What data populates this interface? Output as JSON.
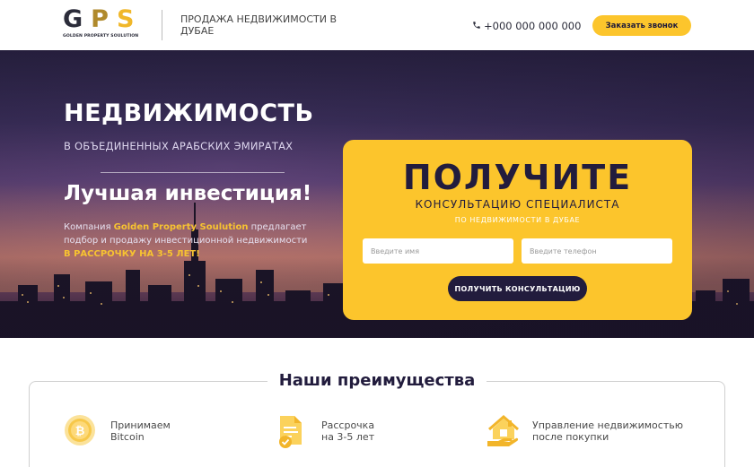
{
  "header": {
    "logo_letters": [
      "G",
      "P",
      "S"
    ],
    "logo_subtitle": "GOLDEN PROPERTY SOULUTION",
    "tagline": "ПРОДАЖА НЕДВИЖИМОСТИ В ДУБАЕ",
    "phone": "+000 000 000 000",
    "callback_button": "Заказать звонок"
  },
  "hero": {
    "title": "НЕДВИЖИМОСТЬ",
    "subtitle": "В ОБЪЕДИНЕННЫХ АРАБСКИХ ЭМИРАТАХ",
    "headline": "Лучшая инвестиция!",
    "desc_prefix": "Компания ",
    "desc_company": "Golden Property Soulution",
    "desc_suffix": " предлагает подбор и продажу инвестиционной недвижимости",
    "installment": "В РАССРОЧКУ НА 3-5 ЛЕТ!"
  },
  "form": {
    "title": "ПОЛУЧИТЕ",
    "subtitle": "КОНСУЛЬТАЦИЮ СПЕЦИАЛИСТА",
    "subtitle2": "ПО НЕДВИЖИМОСТИ В ДУБАЕ",
    "name_placeholder": "Введите имя",
    "phone_placeholder": "Введите телефон",
    "submit_button": "ПОЛУЧИТЬ КОНСУЛЬТАЦИЮ"
  },
  "advantages": {
    "title": "Наши преимущества",
    "items": [
      {
        "icon": "bitcoin-icon",
        "line1": "Принимаем",
        "line2": "Bitcoin"
      },
      {
        "icon": "document-check-icon",
        "line1": "Рассрочка",
        "line2": "на 3-5 лет"
      },
      {
        "icon": "house-hand-icon",
        "line1": "Управление недвижимостью",
        "line2": "после покупки"
      }
    ]
  },
  "colors": {
    "accent": "#fcc52c",
    "dark": "#221c3d",
    "gold_text": "#f7c331"
  }
}
